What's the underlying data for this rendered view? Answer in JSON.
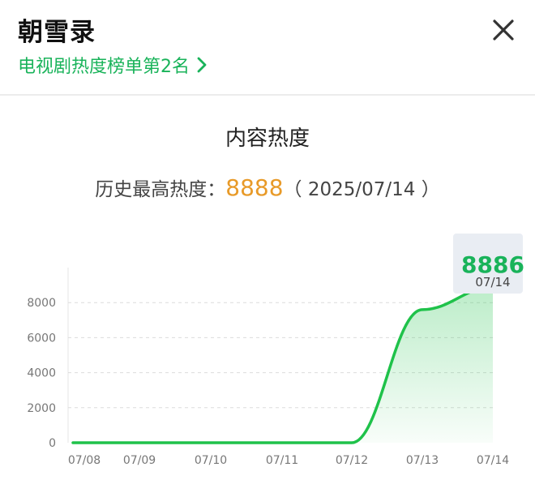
{
  "header": {
    "title": "朝雪录",
    "subtitle": "电视剧热度榜单第2名",
    "close_icon": "close-icon",
    "chevron_icon": "chevron-right-icon"
  },
  "heat": {
    "section_title": "内容热度",
    "peak_label": "历史最高热度：",
    "peak_value": "8888",
    "peak_date": "（ 2025/07/14 ）"
  },
  "tooltip": {
    "value": "8886",
    "date": "07/14"
  },
  "colors": {
    "accent": "#19b35a",
    "line": "#1fc24a",
    "peak": "#e89a28"
  },
  "chart_data": {
    "type": "area",
    "title": "",
    "xlabel": "",
    "ylabel": "",
    "categories": [
      "07/08",
      "07/09",
      "07/10",
      "07/11",
      "07/12",
      "07/13",
      "07/14"
    ],
    "yticks": [
      "0",
      "2000",
      "4000",
      "6000",
      "8000"
    ],
    "ylim": [
      0,
      10000
    ],
    "grid": true,
    "series": [
      {
        "values": [
          0,
          0,
          0,
          0,
          0,
          7600,
          8886
        ]
      }
    ]
  }
}
